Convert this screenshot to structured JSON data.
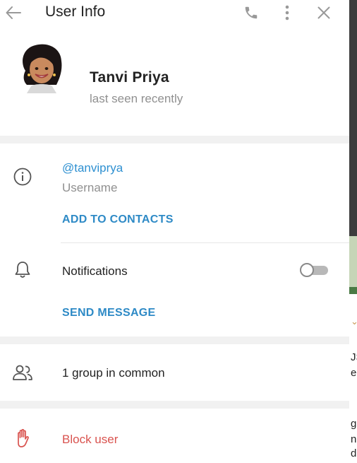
{
  "header": {
    "title": "User Info",
    "back_icon": "arrow-left-icon",
    "call_icon": "phone-icon",
    "menu_icon": "more-vertical-icon",
    "close_icon": "close-icon"
  },
  "profile": {
    "name": "Tanvi Priya",
    "status": "last seen recently"
  },
  "info": {
    "username": "@tanviprya",
    "username_label": "Username",
    "add_contacts": "ADD TO CONTACTS",
    "notifications_label": "Notifications",
    "notifications_enabled": false,
    "send_message": "SEND MESSAGE"
  },
  "common": {
    "groups_label": "1 group in common"
  },
  "block": {
    "label": "Block user"
  },
  "backdrop": {
    "frags": [
      "JS",
      "e",
      "gi",
      "n",
      "d."
    ]
  },
  "colors": {
    "accent": "#2e90d1",
    "danger": "#d9534f",
    "muted": "#909090"
  }
}
